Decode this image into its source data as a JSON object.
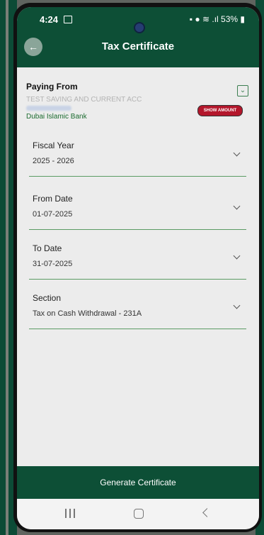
{
  "status_bar": {
    "time": "4:24",
    "battery": "53%",
    "icons": [
      "image-icon",
      "camera-icon",
      "battery-icon",
      "location-icon",
      "wifi-icon",
      "signal-icon"
    ]
  },
  "header": {
    "title": "Tax Certificate",
    "back_icon": "arrow-left-icon"
  },
  "paying_from": {
    "label": "Paying From",
    "account_name": "TEST SAVING AND CURRENT ACC",
    "bank": "Dubai Islamic Bank",
    "show_amount_label": "SHOW AMOUNT",
    "expand_icon": "chevron-down-icon"
  },
  "fields": [
    {
      "label": "Fiscal Year",
      "value": "2025 - 2026"
    },
    {
      "label": "From Date",
      "value": "01-07-2025"
    },
    {
      "label": "To Date",
      "value": "31-07-2025"
    },
    {
      "label": "Section",
      "value": "Tax on Cash Withdrawal - 231A"
    }
  ],
  "action": {
    "generate_label": "Generate Certificate"
  },
  "colors": {
    "primary": "#0d4f36",
    "accent": "#5b9b64",
    "badge": "#b3162b",
    "bank_text": "#1b6b2f"
  },
  "nav": {
    "icons": [
      "recent-apps-icon",
      "home-icon",
      "back-icon"
    ]
  }
}
